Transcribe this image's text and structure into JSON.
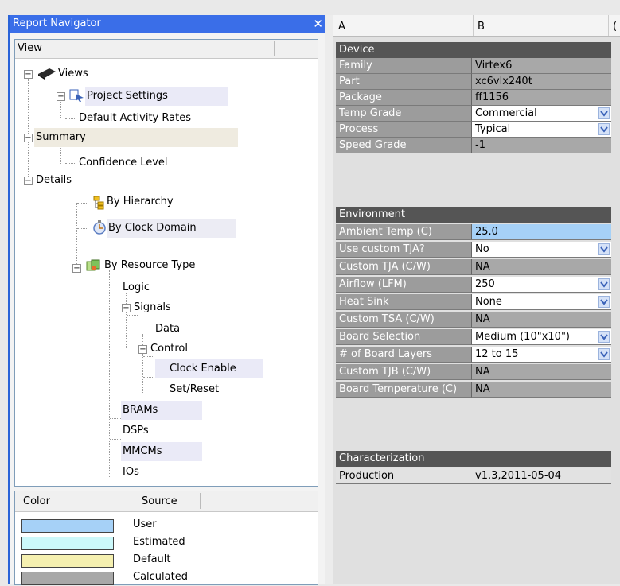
{
  "navigator": {
    "title": "Report Navigator",
    "close": "✕",
    "view_header": "View",
    "tree": {
      "views": "Views",
      "project_settings": "Project Settings",
      "default_activity_rates": "Default Activity Rates",
      "summary": "Summary",
      "confidence_level": "Confidence Level",
      "details": "Details",
      "by_hierarchy": "By Hierarchy",
      "by_clock_domain": "By Clock Domain",
      "by_resource_type": "By Resource Type",
      "logic": "Logic",
      "signals": "Signals",
      "data": "Data",
      "control": "Control",
      "clock_enable": "Clock Enable",
      "set_reset": "Set/Reset",
      "brams": "BRAMs",
      "dsps": "DSPs",
      "mmcms": "MMCMs",
      "ios": "IOs"
    },
    "tree_toggles": {
      "collapse": "−"
    }
  },
  "legend": {
    "header_color": "Color",
    "header_source": "Source",
    "items": [
      {
        "label": "User",
        "color": "#a6d1f7"
      },
      {
        "label": "Estimated",
        "color": "#ccf9fb"
      },
      {
        "label": "Default",
        "color": "#f5f0b0"
      },
      {
        "label": "Calculated",
        "color": "#a8a8a8"
      }
    ]
  },
  "grid": {
    "columns": [
      "A",
      "B",
      "("
    ],
    "device": {
      "title": "Device",
      "family_label": "Family",
      "family_value": "Virtex6",
      "part_label": "Part",
      "part_value": "xc6vlx240t",
      "package_label": "Package",
      "package_value": "ff1156",
      "temp_label": "Temp Grade",
      "temp_value": "Commercial",
      "process_label": "Process",
      "process_value": "Typical",
      "speed_label": "Speed Grade",
      "speed_value": "-1"
    },
    "environment": {
      "title": "Environment",
      "ambient_label": "Ambient Temp (C)",
      "ambient_value": "25.0",
      "tja_use_label": "Use custom TJA?",
      "tja_use_value": "No",
      "tja_label": "Custom TJA (C/W)",
      "tja_value": "NA",
      "airflow_label": "Airflow (LFM)",
      "airflow_value": "250",
      "heatsink_label": "Heat Sink",
      "heatsink_value": "None",
      "tsa_label": "Custom TSA (C/W)",
      "tsa_value": "NA",
      "board_label": "Board Selection",
      "board_value": "Medium (10\"x10\")",
      "layers_label": "# of Board Layers",
      "layers_value": "12 to 15",
      "tjb_label": "Custom TJB (C/W)",
      "tjb_value": "NA",
      "boardtemp_label": "Board Temperature (C)",
      "boardtemp_value": "NA"
    },
    "characterization": {
      "title": "Characterization",
      "prod_label": "Production",
      "prod_value": "v1.3,2011-05-04"
    }
  }
}
